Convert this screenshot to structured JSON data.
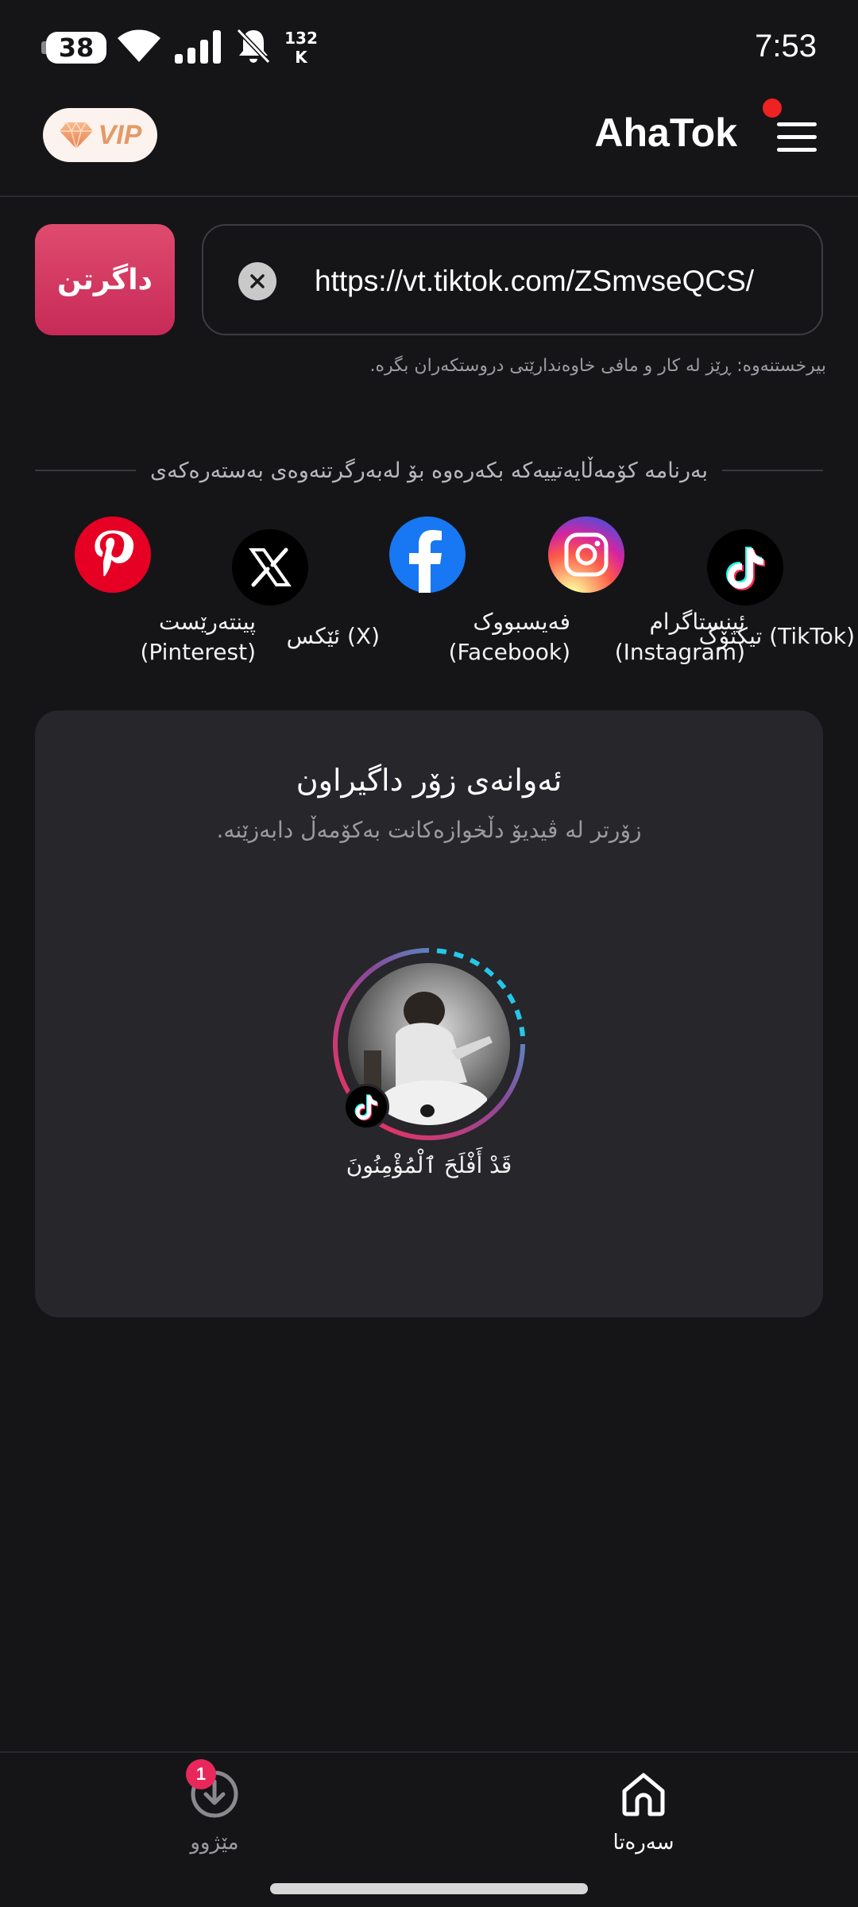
{
  "status_bar": {
    "battery": "38",
    "net_speed_value": "132",
    "net_speed_unit": "K",
    "time": "7:53",
    "icons": [
      "battery-icon",
      "wifi-icon",
      "signal-icon",
      "bell-muted-icon"
    ]
  },
  "header": {
    "vip_label": "VIP",
    "app_title": "AhaTok",
    "menu_icon": "hamburger-menu-icon",
    "notification_dot_color": "#ee2222"
  },
  "url_bar": {
    "download_label": "داگرتن",
    "url_value": "https://vt.tiktok.com/ZSmvseQCS/",
    "clear_icon": "clear-x-icon"
  },
  "disclaimer": "بیرخستنەوە: ڕێز لە کار و مافی خاوەندارێتی دروستکەران بگرە.",
  "platforms_heading": "بەرنامە کۆمەڵایەتییەکە بکەرەوە بۆ لەبەرگرتنەوەی بەستەرەکەی",
  "platforms": [
    {
      "name": "pinterest",
      "label_1": "پینتەرێست",
      "label_2": "(Pinterest)",
      "icon": "pinterest-icon"
    },
    {
      "name": "x",
      "label_1": "ئێکس (X)",
      "label_2": "",
      "icon": "x-icon"
    },
    {
      "name": "facebook",
      "label_1": "فەیسبووک",
      "label_2": "(Facebook)",
      "icon": "facebook-icon"
    },
    {
      "name": "instagram",
      "label_1": "ئینستاگرام",
      "label_2": "(Instagram)",
      "icon": "instagram-icon"
    },
    {
      "name": "tiktok",
      "label_1": "تیکتۆک (TikTok)",
      "label_2": "",
      "icon": "tiktok-icon"
    }
  ],
  "popular": {
    "title": "ئەوانەی زۆر داگیراون",
    "subtitle": "زۆرتر لە ڤیدیۆ دڵخوازەکانت بەکۆمەڵ دابەزێنە.",
    "creator_name": "قَدْ أَفْلَحَ ٱلْمُؤْمِنُونَ"
  },
  "bottom_nav": {
    "history_label": "مێژوو",
    "history_badge": "1",
    "home_label": "سەرەتا"
  },
  "colors": {
    "background": "#151518",
    "card": "#26262b",
    "accent": "#d63a63",
    "badge": "#e8285a"
  }
}
